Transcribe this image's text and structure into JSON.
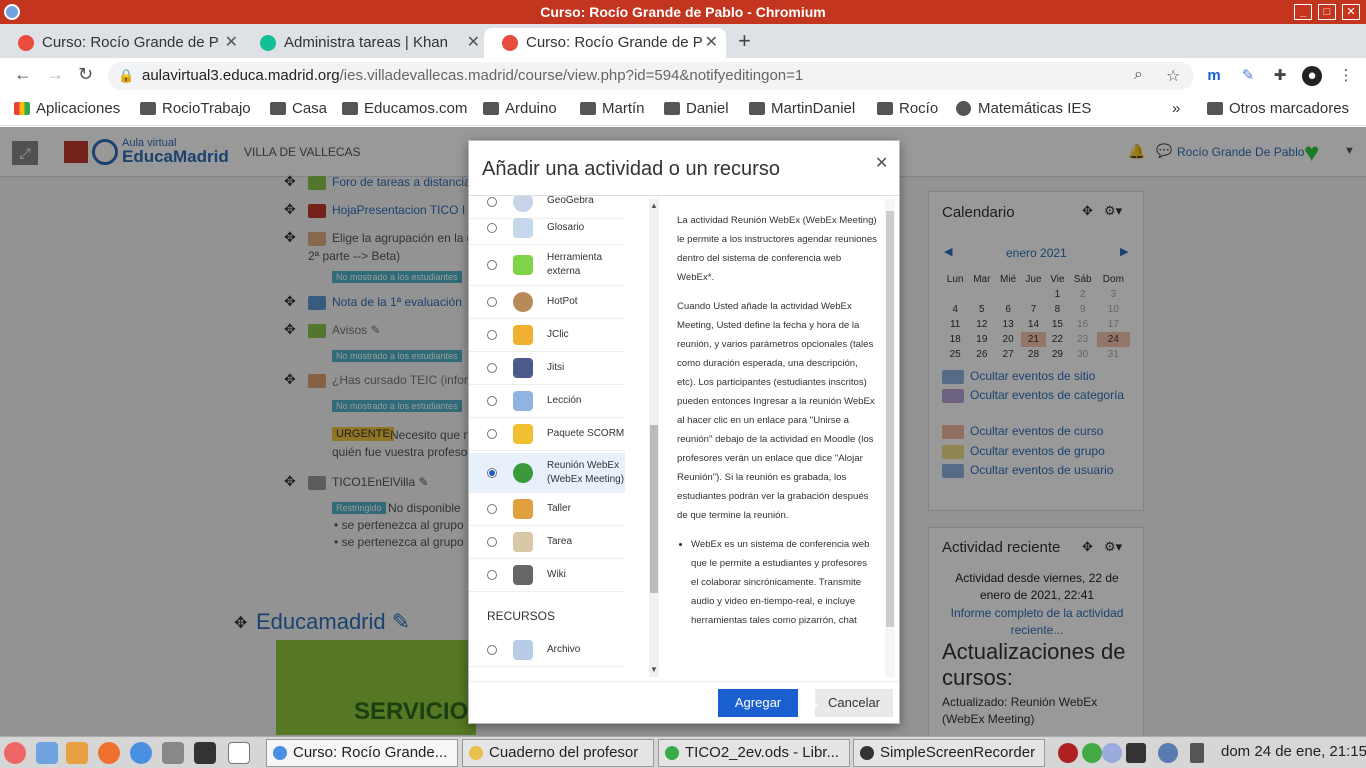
{
  "window": {
    "title": "Curso: Rocío Grande de Pablo - Chromium"
  },
  "tabs": [
    {
      "label": "Curso: Rocío Grande de P"
    },
    {
      "label": "Administra tareas | Khan"
    },
    {
      "label": "Curso: Rocío Grande de P"
    }
  ],
  "address": {
    "host": "aulavirtual3.educa.madrid.org",
    "path": "/ies.villadevallecas.madrid/course/view.php?id=594&notifyeditingon=1"
  },
  "bookmarks": [
    "Aplicaciones",
    "RocioTrabajo",
    "Casa",
    "Educamos.com",
    "Arduino",
    "Martín",
    "Daniel",
    "MartinDaniel",
    "Rocío",
    "Matemáticas IES",
    "Otros marcadores"
  ],
  "site": {
    "logo_small": "Aula virtual",
    "logo_big": "EducaMadrid",
    "school": "VILLA DE VALLECAS",
    "user": "Rocío Grande De Pablo"
  },
  "course": {
    "items": [
      "Foro de tareas a distancia",
      "HojaPresentacion TICO I 2",
      "Elige la agrupación en la g",
      "2ª parte --> Beta)",
      "Nota de la 1ª evaluación",
      "Avisos",
      "¿Has cursado TEIC (inform",
      "Necesito que n",
      "quién fue vuestra profesor",
      "TICO1EnElVilla",
      "No disponible",
      "se pertenezca al grupo",
      "se pertenezca al grupo"
    ],
    "hidden_badge": "No mostrado a los estudiantes",
    "urgent": "URGENTE",
    "restricted": "Restringido",
    "section_title": "Educamadrid",
    "banner_text": "SERVICIOS"
  },
  "calendar": {
    "title": "Calendario",
    "month": "enero 2021",
    "weekdays": [
      "Lun",
      "Mar",
      "Mié",
      "Jue",
      "Vie",
      "Sáb",
      "Dom"
    ],
    "weeks": [
      [
        "",
        "",
        "",
        "",
        "1",
        "2",
        "3"
      ],
      [
        "4",
        "5",
        "6",
        "7",
        "8",
        "9",
        "10"
      ],
      [
        "11",
        "12",
        "13",
        "14",
        "15",
        "16",
        "17"
      ],
      [
        "18",
        "19",
        "20",
        "21",
        "22",
        "23",
        "24"
      ],
      [
        "25",
        "26",
        "27",
        "28",
        "29",
        "30",
        "31"
      ]
    ],
    "links": [
      "Ocultar eventos de sitio",
      "Ocultar eventos de categoría",
      "Ocultar eventos de curso",
      "Ocultar eventos de grupo",
      "Ocultar eventos de usuario"
    ]
  },
  "recent": {
    "title": "Actividad reciente",
    "since": "Actividad desde viernes, 22 de enero de 2021, 22:41",
    "report_link": "Informe completo de la actividad reciente...",
    "updates_title": "Actualizaciones de cursos:",
    "updated": "Actualizado: Reunión WebEx (WebEx Meeting)"
  },
  "modal": {
    "title": "Añadir una actividad o un recurso",
    "options": [
      "GeoGebra",
      "Glosario",
      "Herramienta externa",
      "HotPot",
      "JClic",
      "Jitsi",
      "Lección",
      "Paquete SCORM",
      "Reunión WebEx (WebEx Meeting)",
      "Taller",
      "Tarea",
      "Wiki"
    ],
    "resources_heading": "RECURSOS",
    "resources": [
      "Archivo"
    ],
    "help_p1": "La actividad Reunión WebEx (WebEx Meeting) le permite a los instructores agendar reuniones dentro del sistema de conferencia web WebEx*.",
    "help_p2": "Cuando Usted añade la actividad WebEx Meeting, Usted define la fecha y hora de la reunión, y varios parámetros opcionales (tales como duración esperada, una descripción, etc). Los participantes (estudiantes inscritos) pueden entonces Ingresar a la reunión WebEx al hacer clic en un enlace para \"Unirse a reunión\" debajo de la actividad en Moodle (los profesores verán un enlace que dice \"Alojar Reunión\"). Si la reunión es grabada, los estudiantes podrán ver la grabación después de que termine la reunión.",
    "help_li1": "WebEx es un sistema de conferencia web que le permite a estudiantes y profesores el colaborar sincrónicamente. Transmite audio y video en-tiempo-real, e incluye herramientas tales como pizarrón, chat",
    "add_label": "Agregar",
    "cancel_label": "Cancelar"
  },
  "taskbar": {
    "tasks": [
      "Curso: Rocío Grande...",
      "Cuaderno del profesor",
      "TICO2_2ev.ods - Libr...",
      "SimpleScreenRecorder"
    ],
    "clock": "dom 24 de ene, 21:15"
  }
}
